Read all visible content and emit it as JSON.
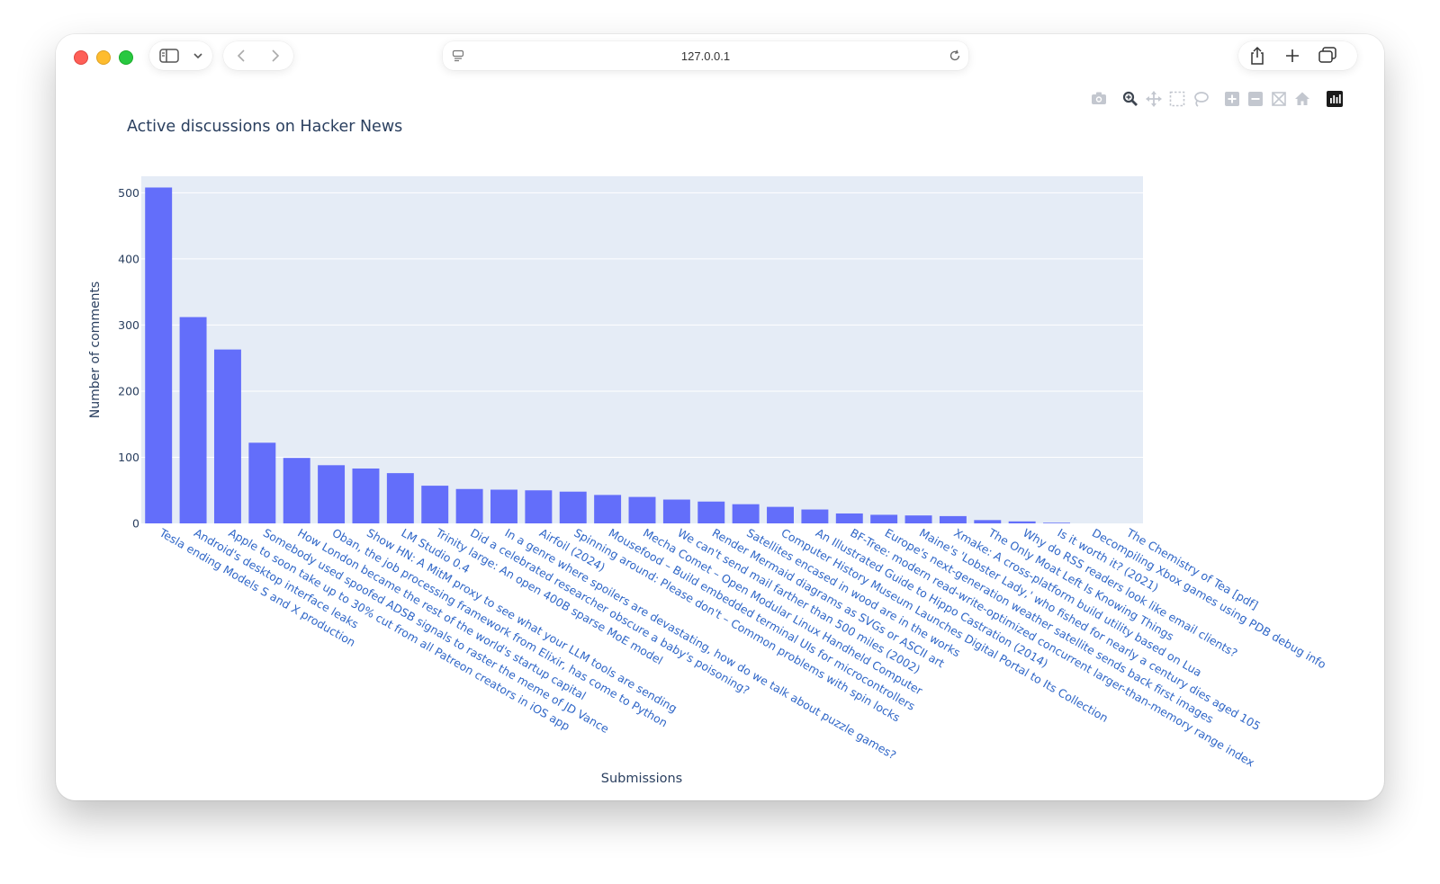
{
  "browser": {
    "address": "127.0.0.1",
    "icons": [
      "sidebar-toggle-icon",
      "chevron-down-icon",
      "back-icon",
      "forward-icon",
      "page-icon",
      "reload-icon",
      "share-icon",
      "new-tab-icon",
      "tabs-overview-icon"
    ]
  },
  "modebar": {
    "icons": [
      "camera-icon",
      "zoom-icon",
      "pan-icon",
      "box-select-icon",
      "lasso-select-icon",
      "zoom-in-icon",
      "zoom-out-icon",
      "autoscale-icon",
      "reset-axes-icon",
      "plotly-logo-icon"
    ]
  },
  "colors": {
    "bar": "#636efa",
    "plot_background": "#e5ecf6",
    "gridline": "#ffffff",
    "title": "#2a3f5f",
    "tick_label": "#2a3f5f",
    "category_label": "#2f66c7"
  },
  "chart_data": {
    "type": "bar",
    "title": "Active discussions on Hacker News",
    "xlabel": "Submissions",
    "ylabel": "Number of comments",
    "ylim": [
      0,
      525
    ],
    "yticks": [
      0,
      100,
      200,
      300,
      400,
      500
    ],
    "grid": true,
    "legend": false,
    "categories": [
      "Tesla ending Models S and X production",
      "Android's desktop interface leaks",
      "Apple to soon take up to 30% cut from all Patreon creators in iOS app",
      "Somebody used spoofed ADSB signals to raster the meme of JD Vance",
      "How London became the rest of the world's startup capital",
      "Oban, the job processing framework from Elixir, has come to Python",
      "Show HN: A MitM proxy to see what your LLM tools are sending",
      "LM Studio 0.4",
      "Trinity large: An open 400B sparse MoE model",
      "Did a celebrated researcher obscure a baby's poisoning?",
      "In a genre where spoilers are devastating, how do we talk about puzzle games?",
      "Airfoil (2024)",
      "Spinning around: Please don't – Common problems with spin locks",
      "Mousefood – Build embedded terminal UIs for microcontrollers",
      "Mecha Comet – Open Modular Linux Handheld Computer",
      "We can't send mail farther than 500 miles (2002)",
      "Render Mermaid diagrams as SVGs or ASCII art",
      "Satellites encased in wood are in the works",
      "Computer History Museum Launches Digital Portal to Its Collection",
      "An Illustrated Guide to Hippo Castration (2014)",
      "BF-Tree: modern read-write-optimized concurrent larger-than-memory range index",
      "Europe's next-generation weather satellite sends back first images",
      "Maine's 'Lobster Lady,' who fished for nearly a century dies aged 105",
      "Xmake: A cross-platform build utility based on Lua",
      "The Only Moat Left Is Knowing Things",
      "Why do RSS readers look like email clients?",
      "Is it worth it? (2021)",
      "Decompiling Xbox games using PDB debug info",
      "The Chemistry of Tea [pdf]"
    ],
    "values": [
      508,
      312,
      263,
      122,
      99,
      88,
      83,
      76,
      57,
      52,
      51,
      50,
      48,
      43,
      40,
      36,
      33,
      29,
      25,
      21,
      15,
      13,
      12,
      11,
      5,
      3,
      1,
      0,
      0
    ]
  }
}
